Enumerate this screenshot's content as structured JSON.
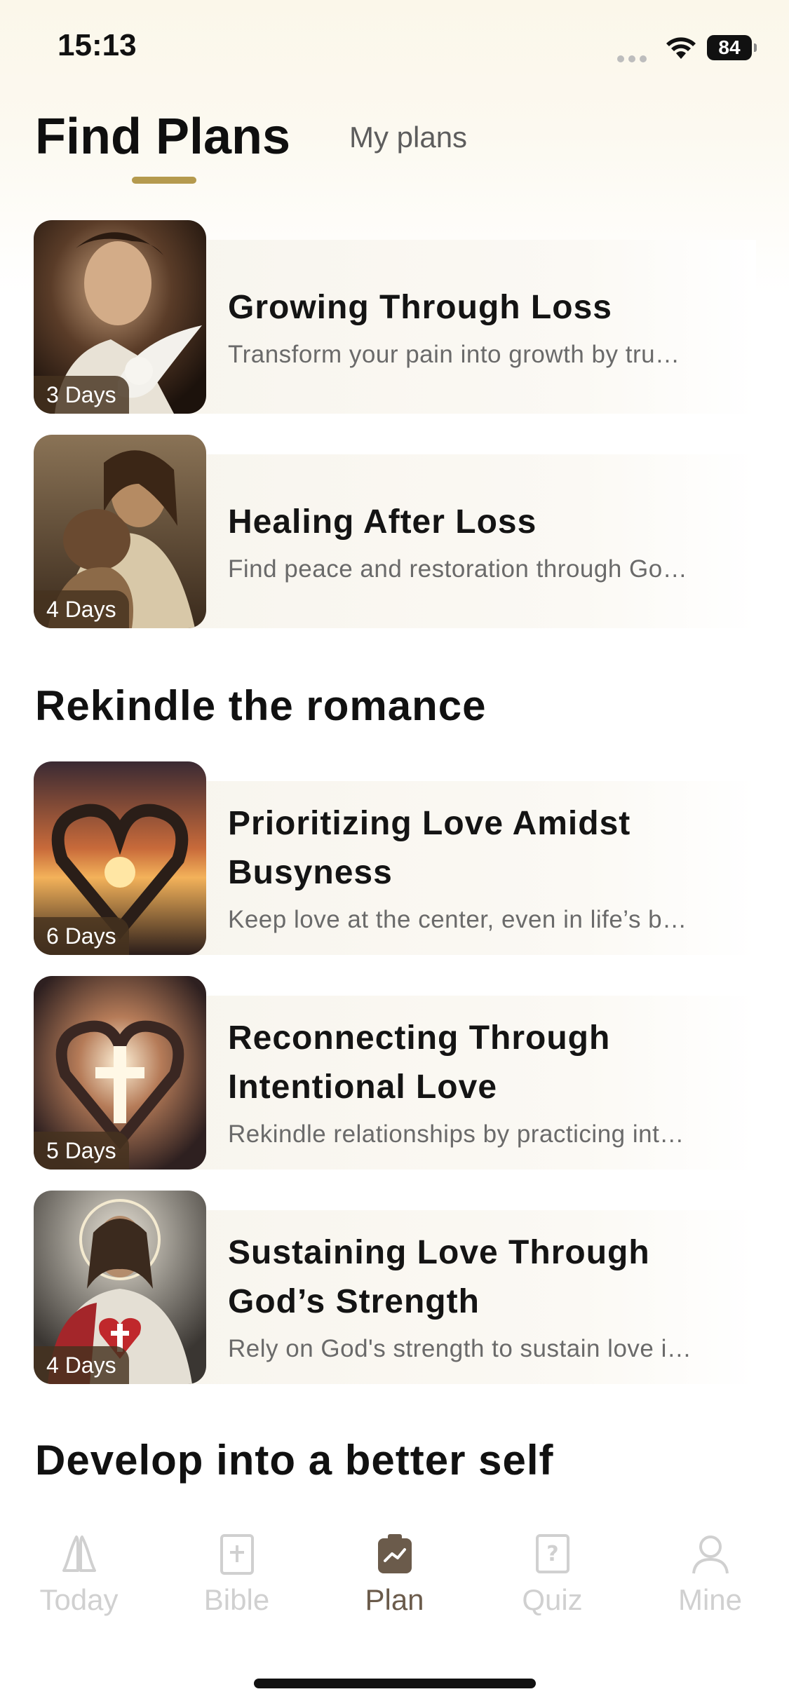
{
  "status_bar": {
    "time": "15:13",
    "battery": "84"
  },
  "tabs": {
    "active": "Find Plans",
    "inactive": "My plans"
  },
  "sections": [
    {
      "title": "",
      "plans": [
        {
          "title": "Growing Through Loss",
          "description": "Transform your pain into growth by tru…",
          "days": "3 Days"
        },
        {
          "title": "Healing After Loss",
          "description": "Find peace and restoration through Go…",
          "days": "4 Days"
        }
      ]
    },
    {
      "title": "Rekindle the romance",
      "plans": [
        {
          "title": "Prioritizing Love Amidst Busyness",
          "description": "Keep love at the center, even in life’s b…",
          "days": "6 Days"
        },
        {
          "title": "Reconnecting Through Intentional Love",
          "description": "Rekindle relationships by practicing int…",
          "days": "5 Days"
        },
        {
          "title": "Sustaining Love Through God’s Strength",
          "description": "Rely on God's strength to sustain love i…",
          "days": "4 Days"
        }
      ]
    },
    {
      "title": "Develop into a better self",
      "plans": []
    }
  ],
  "bottom_nav": [
    {
      "label": "Today",
      "icon": "praying-hands-icon",
      "active": false
    },
    {
      "label": "Bible",
      "icon": "bible-book-icon",
      "active": false
    },
    {
      "label": "Plan",
      "icon": "plan-clipboard-icon",
      "active": true
    },
    {
      "label": "Quiz",
      "icon": "quiz-icon",
      "active": false
    },
    {
      "label": "Mine",
      "icon": "profile-icon",
      "active": false
    }
  ],
  "colors": {
    "accent": "#b59a4e",
    "active_nav": "#6b5b4b",
    "inactive_nav": "#d0d0d0",
    "badge_bg": "#46321e"
  }
}
